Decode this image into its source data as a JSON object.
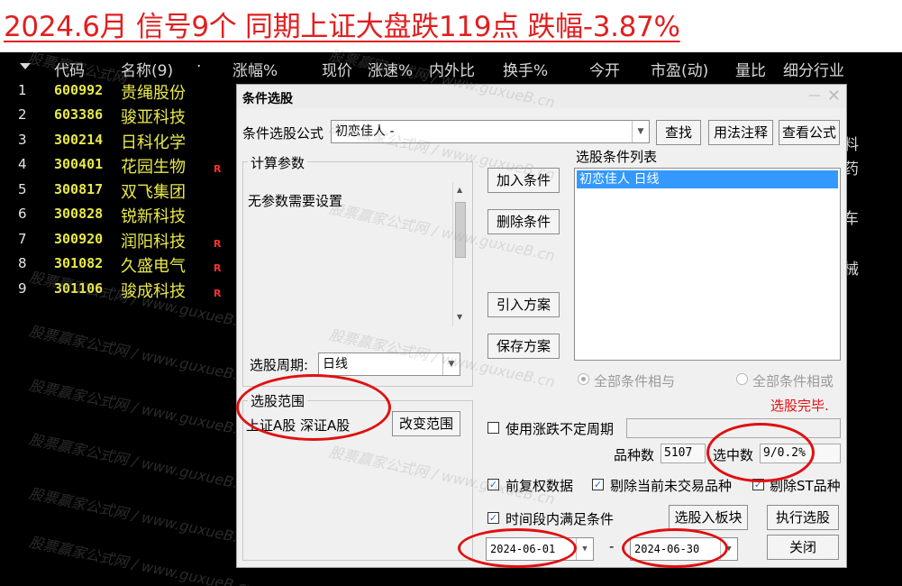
{
  "banner": {
    "title": "2024.6月 信号9个 同期上证大盘跌119点 跌幅-3.87%"
  },
  "table": {
    "headers": [
      "代码",
      "名称(9)",
      "·",
      "涨幅%",
      "现价",
      "涨速%",
      "内外比",
      "换手%",
      "今开",
      "市盈(动)",
      "量比",
      "细分行业"
    ],
    "rows": [
      {
        "idx": "1",
        "code": "600992",
        "name": "贵绳股份",
        "flag": ""
      },
      {
        "idx": "2",
        "code": "603386",
        "name": "骏亚科技",
        "flag": ""
      },
      {
        "idx": "3",
        "code": "300214",
        "name": "日科化学",
        "flag": ""
      },
      {
        "idx": "4",
        "code": "300401",
        "name": "花园生物",
        "flag": "R"
      },
      {
        "idx": "5",
        "code": "300817",
        "name": "双飞集团",
        "flag": ""
      },
      {
        "idx": "6",
        "code": "300828",
        "name": "锐新科技",
        "flag": ""
      },
      {
        "idx": "7",
        "code": "300920",
        "name": "润阳科技",
        "flag": "R"
      },
      {
        "idx": "8",
        "code": "301082",
        "name": "久盛电气",
        "flag": "R"
      },
      {
        "idx": "9",
        "code": "301106",
        "name": "骏成科技",
        "flag": "R"
      }
    ],
    "right_edge_chars": [
      "料",
      "药",
      "车",
      "械"
    ]
  },
  "watermark": {
    "text1": "股票赢家公式网",
    "text2": "www.guxueB.cn",
    "sep": "/"
  },
  "dialog": {
    "title": "条件选股",
    "formula_label": "条件选股公式",
    "formula_value": "初恋佳人  -",
    "find_btn": "查找",
    "usage_btn": "用法注释",
    "view_formula_btn": "查看公式",
    "params_group": "计算参数",
    "params_text": "无参数需要设置",
    "period_label": "选股周期:",
    "period_value": "日线",
    "scope_group": "选股范围",
    "scope_value": "上证A股 深证A股",
    "change_scope_btn": "改变范围",
    "add_cond_btn": "加入条件",
    "del_cond_btn": "删除条件",
    "import_btn": "引入方案",
    "save_btn": "保存方案",
    "cond_list_label": "选股条件列表",
    "cond_list_items": [
      "初恋佳人   日线"
    ],
    "radio_and": "全部条件相与",
    "radio_or": "全部条件相或",
    "status": "选股完毕.",
    "use_updown_label": "使用涨跌不定周期",
    "count_label": "品种数",
    "count_value": "5107",
    "selected_label": "选中数",
    "selected_value": "9/0.2%",
    "cb_adjust": "前复权数据",
    "cb_exclude_untraded": "剔除当前未交易品种",
    "cb_exclude_st": "剔除ST品种",
    "cb_time_range": "时间段内满足条件",
    "to_block_btn": "选股入板块",
    "execute_btn": "执行选股",
    "date_from": "2024-06-01",
    "date_sep": "-",
    "date_to": "2024-06-30",
    "close_btn": "关闭"
  },
  "colors": {
    "accent_red": "#e01010",
    "stock_yellow": "#e8e84a",
    "selection_blue": "#3399ff"
  }
}
